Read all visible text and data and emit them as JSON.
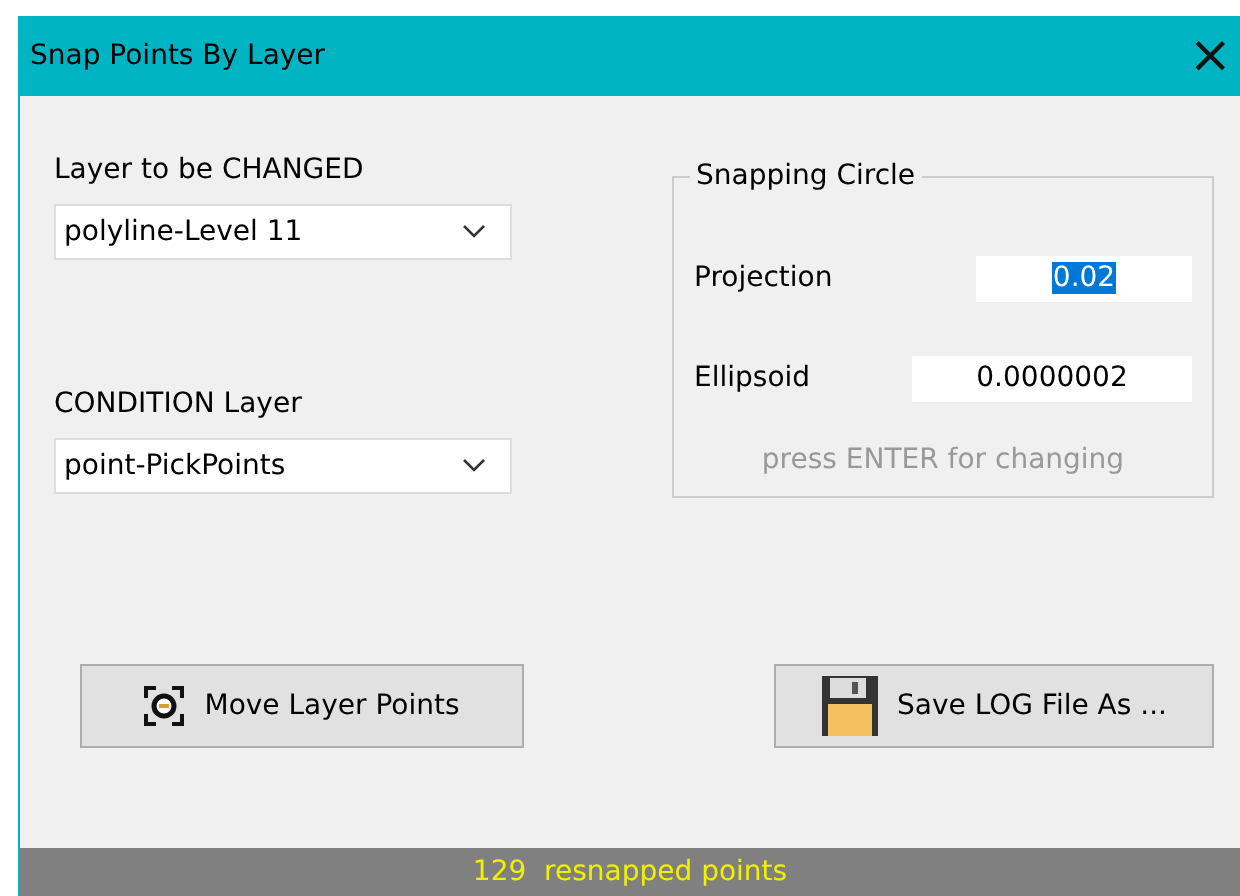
{
  "window": {
    "title": "Snap Points By Layer",
    "close": "×"
  },
  "layer_changed": {
    "label": "Layer to be CHANGED",
    "value": "polyline-Level 11"
  },
  "condition_layer": {
    "label": "CONDITION Layer",
    "value": "point-PickPoints"
  },
  "snapping_circle": {
    "title": "Snapping Circle",
    "fields": [
      {
        "label": "Projection",
        "value": "0.02",
        "highlighted": true
      },
      {
        "label": "Ellipsoid",
        "value": "0.0000002",
        "highlighted": false
      }
    ],
    "hint": "press ENTER for changing"
  },
  "buttons": [
    {
      "label": "Move Layer Points",
      "kind": "target"
    },
    {
      "label": "Save LOG File As ...",
      "kind": "save"
    }
  ],
  "status_bar": "129  resnapped points"
}
